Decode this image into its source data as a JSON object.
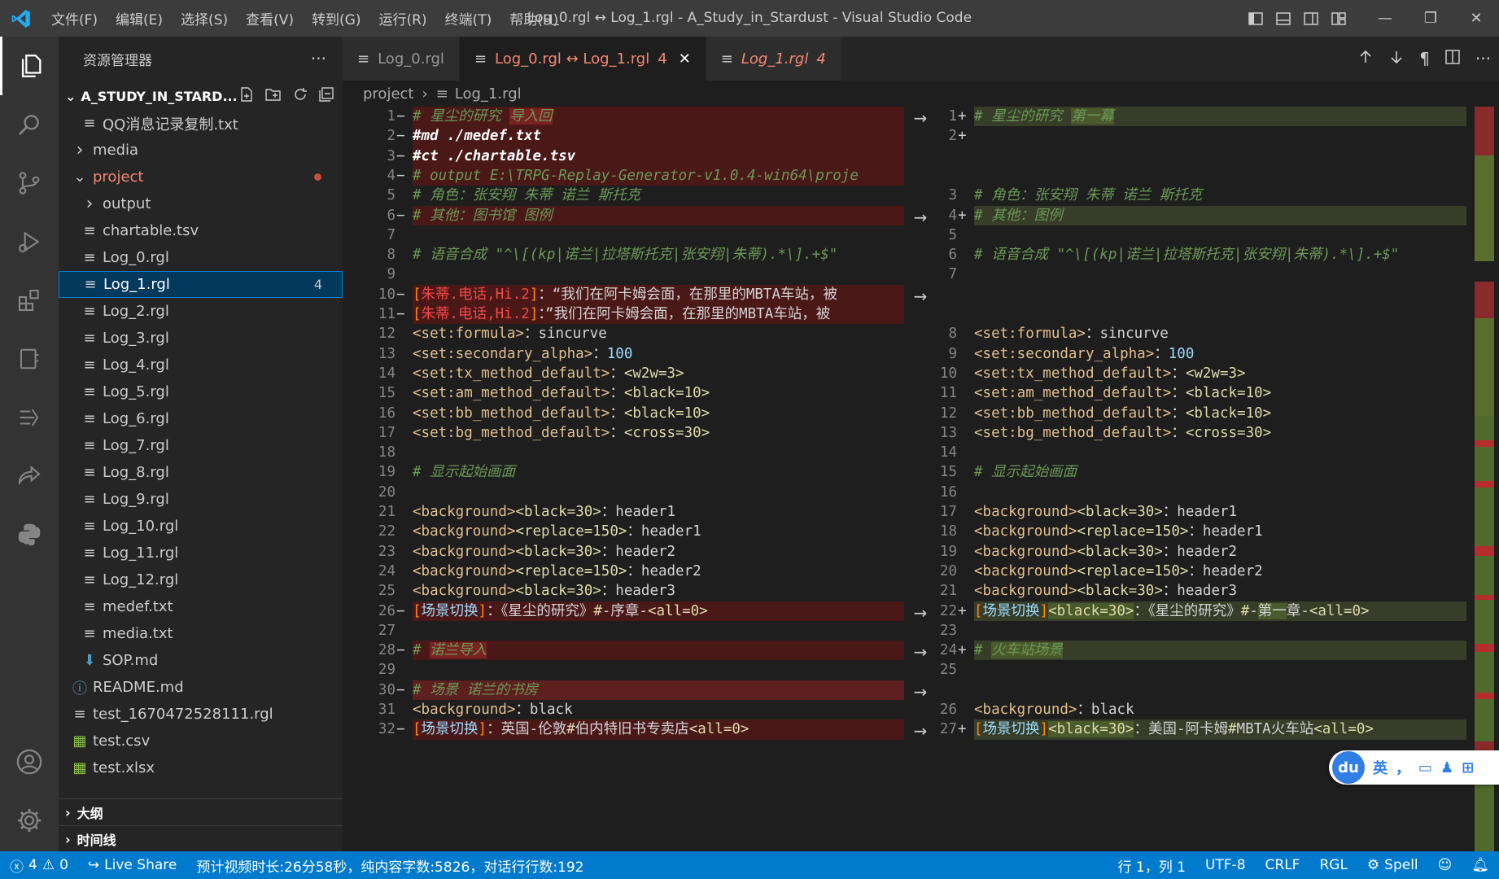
{
  "window": {
    "title": "Log_0.rgl ↔ Log_1.rgl - A_Study_in_Stardust - Visual Studio Code",
    "menu": [
      "文件(F)",
      "编辑(E)",
      "选择(S)",
      "查看(V)",
      "转到(G)",
      "运行(R)",
      "终端(T)",
      "帮助(H)"
    ]
  },
  "sidebar": {
    "title": "资源管理器",
    "folder": "A_STUDY_IN_STARD...",
    "items": [
      {
        "label": "QQ消息记录复制.txt",
        "indent": 2,
        "kind": "file"
      },
      {
        "label": "media",
        "indent": 1,
        "kind": "folder-closed"
      },
      {
        "label": "project",
        "indent": 1,
        "kind": "folder-open"
      },
      {
        "label": "output",
        "indent": 2,
        "kind": "folder-closed"
      },
      {
        "label": "chartable.tsv",
        "indent": 2,
        "kind": "file"
      },
      {
        "label": "Log_0.rgl",
        "indent": 2,
        "kind": "file"
      },
      {
        "label": "Log_1.rgl",
        "indent": 2,
        "kind": "file",
        "badge": "4"
      },
      {
        "label": "Log_2.rgl",
        "indent": 2,
        "kind": "file"
      },
      {
        "label": "Log_3.rgl",
        "indent": 2,
        "kind": "file"
      },
      {
        "label": "Log_4.rgl",
        "indent": 2,
        "kind": "file"
      },
      {
        "label": "Log_5.rgl",
        "indent": 2,
        "kind": "file"
      },
      {
        "label": "Log_6.rgl",
        "indent": 2,
        "kind": "file"
      },
      {
        "label": "Log_7.rgl",
        "indent": 2,
        "kind": "file"
      },
      {
        "label": "Log_8.rgl",
        "indent": 2,
        "kind": "file"
      },
      {
        "label": "Log_9.rgl",
        "indent": 2,
        "kind": "file"
      },
      {
        "label": "Log_10.rgl",
        "indent": 2,
        "kind": "file"
      },
      {
        "label": "Log_11.rgl",
        "indent": 2,
        "kind": "file"
      },
      {
        "label": "Log_12.rgl",
        "indent": 2,
        "kind": "file"
      },
      {
        "label": "medef.txt",
        "indent": 2,
        "kind": "file"
      },
      {
        "label": "media.txt",
        "indent": 2,
        "kind": "file"
      },
      {
        "label": "SOP.md",
        "indent": 2,
        "kind": "md"
      },
      {
        "label": "README.md",
        "indent": 1,
        "kind": "info"
      },
      {
        "label": "test_1670472528111.rgl",
        "indent": 1,
        "kind": "file"
      },
      {
        "label": "test.csv",
        "indent": 1,
        "kind": "csv"
      },
      {
        "label": "test.xlsx",
        "indent": 1,
        "kind": "xlsx"
      }
    ],
    "outline": "大纲",
    "timeline": "时间线"
  },
  "tabs": [
    {
      "label": "Log_0.rgl",
      "active": false,
      "modified": false
    },
    {
      "label": "Log_0.rgl ↔ Log_1.rgl",
      "badge": "4",
      "active": true,
      "close": "✕"
    },
    {
      "label": "Log_1.rgl",
      "badge": "4",
      "active": false,
      "italic": true
    }
  ],
  "breadcrumb": {
    "folder": "project",
    "file": "Log_1.rgl"
  },
  "left_lines": [
    {
      "n": "1",
      "m": "−",
      "t": "del",
      "parts": [
        [
          "c-com",
          "# 星尘的研究 "
        ],
        [
          "c-com hl-del",
          "导入回"
        ]
      ]
    },
    {
      "n": "2",
      "m": "−",
      "t": "del",
      "parts": [
        [
          "c-dir",
          "#md ./medef.txt"
        ]
      ]
    },
    {
      "n": "3",
      "m": "−",
      "t": "del",
      "parts": [
        [
          "c-dir",
          "#ct ./chartable.tsv"
        ]
      ]
    },
    {
      "n": "4",
      "m": "−",
      "t": "del",
      "parts": [
        [
          "c-com",
          "# output E:\\TRPG-Replay-Generator-v1.0.4-win64\\proje"
        ]
      ]
    },
    {
      "n": "5",
      "m": "",
      "t": "",
      "parts": [
        [
          "c-com",
          "# 角色：张安翔 朱蒂 诺兰 斯托克"
        ]
      ]
    },
    {
      "n": "6",
      "m": "−",
      "t": "del",
      "parts": [
        [
          "c-com",
          "# 其他：图书馆 图例"
        ]
      ]
    },
    {
      "n": "7",
      "m": "",
      "t": "",
      "parts": []
    },
    {
      "n": "8",
      "m": "",
      "t": "",
      "parts": [
        [
          "c-com",
          "# 语音合成 \"^\\[(kp|诺兰|拉塔斯托克|张安翔|朱蒂).*\\].+$\""
        ]
      ]
    },
    {
      "n": "9",
      "m": "",
      "t": "",
      "parts": []
    },
    {
      "n": "10",
      "m": "−",
      "t": "del",
      "parts": [
        [
          "c-org",
          "["
        ],
        [
          "c-red",
          "朱蒂.电话,Hi.2"
        ],
        [
          "c-org",
          "]"
        ],
        [
          "",
          "：“我们在阿卡姆会面，在那里的MBTA车站，被"
        ]
      ]
    },
    {
      "n": "11",
      "m": "−",
      "t": "del",
      "parts": [
        [
          "c-org",
          "["
        ],
        [
          "c-red",
          "朱蒂.电话,Hi.2"
        ],
        [
          "c-org",
          "]"
        ],
        [
          "",
          "：”我们在阿卡姆会面，在那里的MBTA车站，被"
        ]
      ]
    },
    {
      "n": "12",
      "m": "",
      "t": "",
      "parts": [
        [
          "c-yel",
          "<set:formula>"
        ],
        [
          "",
          "：sincurve"
        ]
      ]
    },
    {
      "n": "13",
      "m": "",
      "t": "",
      "parts": [
        [
          "c-yel",
          "<set:secondary_alpha>"
        ],
        [
          "",
          "："
        ],
        [
          "c-blue",
          "100"
        ]
      ]
    },
    {
      "n": "14",
      "m": "",
      "t": "",
      "parts": [
        [
          "c-yel",
          "<set:tx_method_default>"
        ],
        [
          "",
          "："
        ],
        [
          "c-tag2",
          "<w2w=3>"
        ]
      ]
    },
    {
      "n": "15",
      "m": "",
      "t": "",
      "parts": [
        [
          "c-yel",
          "<set:am_method_default>"
        ],
        [
          "",
          "："
        ],
        [
          "c-tag2",
          "<black=10>"
        ]
      ]
    },
    {
      "n": "16",
      "m": "",
      "t": "",
      "parts": [
        [
          "c-yel",
          "<set:bb_method_default>"
        ],
        [
          "",
          "："
        ],
        [
          "c-tag2",
          "<black=10>"
        ]
      ]
    },
    {
      "n": "17",
      "m": "",
      "t": "",
      "parts": [
        [
          "c-yel",
          "<set:bg_method_default>"
        ],
        [
          "",
          "："
        ],
        [
          "c-tag2",
          "<cross=30>"
        ]
      ]
    },
    {
      "n": "18",
      "m": "",
      "t": "",
      "parts": []
    },
    {
      "n": "19",
      "m": "",
      "t": "",
      "parts": [
        [
          "c-com",
          "# 显示起始画面"
        ]
      ]
    },
    {
      "n": "20",
      "m": "",
      "t": "",
      "parts": []
    },
    {
      "n": "21",
      "m": "",
      "t": "",
      "parts": [
        [
          "c-yel",
          "<background>"
        ],
        [
          "c-tag2",
          "<black=30>"
        ],
        [
          "",
          "：header1"
        ]
      ]
    },
    {
      "n": "22",
      "m": "",
      "t": "",
      "parts": [
        [
          "c-yel",
          "<background>"
        ],
        [
          "c-tag2",
          "<replace=150>"
        ],
        [
          "",
          "：header1"
        ]
      ]
    },
    {
      "n": "23",
      "m": "",
      "t": "",
      "parts": [
        [
          "c-yel",
          "<background>"
        ],
        [
          "c-tag2",
          "<black=30>"
        ],
        [
          "",
          "：header2"
        ]
      ]
    },
    {
      "n": "24",
      "m": "",
      "t": "",
      "parts": [
        [
          "c-yel",
          "<background>"
        ],
        [
          "c-tag2",
          "<replace=150>"
        ],
        [
          "",
          "：header2"
        ]
      ]
    },
    {
      "n": "25",
      "m": "",
      "t": "",
      "parts": [
        [
          "c-yel",
          "<background>"
        ],
        [
          "c-tag2",
          "<black=30>"
        ],
        [
          "",
          "：header3"
        ]
      ]
    },
    {
      "n": "26",
      "m": "−",
      "t": "del",
      "parts": [
        [
          "c-org",
          "["
        ],
        [
          "c-blue",
          "场景切换"
        ],
        [
          "c-org",
          "]"
        ],
        [
          "",
          "：《星尘的研究》"
        ],
        [
          "c-tag2",
          "#"
        ],
        [
          "",
          "-序章-"
        ],
        [
          "c-tag2",
          "<all=0>"
        ]
      ]
    },
    {
      "n": "27",
      "m": "",
      "t": "",
      "parts": []
    },
    {
      "n": "28",
      "m": "−",
      "t": "del",
      "parts": [
        [
          "c-com",
          "# "
        ],
        [
          "c-com hl-del",
          "诺兰导入"
        ]
      ]
    },
    {
      "n": "29",
      "m": "",
      "t": "",
      "parts": []
    },
    {
      "n": "30",
      "m": "−",
      "t": "del strong",
      "parts": [
        [
          "c-com",
          "# 场景 诺兰的书房"
        ]
      ]
    },
    {
      "n": "31",
      "m": "",
      "t": "",
      "parts": [
        [
          "c-yel",
          "<background>"
        ],
        [
          "",
          "：black"
        ]
      ]
    },
    {
      "n": "32",
      "m": "−",
      "t": "del",
      "parts": [
        [
          "c-org",
          "["
        ],
        [
          "c-blue",
          "场景切换"
        ],
        [
          "c-org",
          "]"
        ],
        [
          "",
          "：英国-伦敦"
        ],
        [
          "c-tag2",
          "#"
        ],
        [
          "",
          "伯内特旧书专卖店"
        ],
        [
          "c-tag2",
          "<all=0>"
        ]
      ]
    }
  ],
  "right_lines": [
    {
      "n": "1",
      "m": "+",
      "t": "ins",
      "parts": [
        [
          "c-com",
          "# 星尘的研究 "
        ],
        [
          "c-com hl-ins",
          "第一幕"
        ]
      ]
    },
    {
      "n": "2",
      "m": "+",
      "t": "ins",
      "parts": []
    },
    {
      "n": "",
      "m": "",
      "t": "hatch",
      "parts": []
    },
    {
      "n": "",
      "m": "",
      "t": "hatch",
      "parts": []
    },
    {
      "n": "3",
      "m": "",
      "t": "",
      "parts": [
        [
          "c-com",
          "# 角色：张安翔 朱蒂 诺兰 斯托克"
        ]
      ]
    },
    {
      "n": "4",
      "m": "+",
      "t": "ins",
      "parts": [
        [
          "c-com",
          "# 其他：图例"
        ]
      ]
    },
    {
      "n": "5",
      "m": "",
      "t": "",
      "parts": []
    },
    {
      "n": "6",
      "m": "",
      "t": "",
      "parts": [
        [
          "c-com",
          "# 语音合成 \"^\\[(kp|诺兰|拉塔斯托克|张安翔|朱蒂).*\\].+$\""
        ]
      ]
    },
    {
      "n": "7",
      "m": "",
      "t": "",
      "parts": []
    },
    {
      "n": "",
      "m": "",
      "t": "hatch",
      "parts": []
    },
    {
      "n": "",
      "m": "",
      "t": "hatch",
      "parts": []
    },
    {
      "n": "8",
      "m": "",
      "t": "",
      "parts": [
        [
          "c-yel",
          "<set:formula>"
        ],
        [
          "",
          "：sincurve"
        ]
      ]
    },
    {
      "n": "9",
      "m": "",
      "t": "",
      "parts": [
        [
          "c-yel",
          "<set:secondary_alpha>"
        ],
        [
          "",
          "："
        ],
        [
          "c-blue",
          "100"
        ]
      ]
    },
    {
      "n": "10",
      "m": "",
      "t": "",
      "parts": [
        [
          "c-yel",
          "<set:tx_method_default>"
        ],
        [
          "",
          "："
        ],
        [
          "c-tag2",
          "<w2w=3>"
        ]
      ]
    },
    {
      "n": "11",
      "m": "",
      "t": "",
      "parts": [
        [
          "c-yel",
          "<set:am_method_default>"
        ],
        [
          "",
          "："
        ],
        [
          "c-tag2",
          "<black=10>"
        ]
      ]
    },
    {
      "n": "12",
      "m": "",
      "t": "",
      "parts": [
        [
          "c-yel",
          "<set:bb_method_default>"
        ],
        [
          "",
          "："
        ],
        [
          "c-tag2",
          "<black=10>"
        ]
      ]
    },
    {
      "n": "13",
      "m": "",
      "t": "",
      "parts": [
        [
          "c-yel",
          "<set:bg_method_default>"
        ],
        [
          "",
          "："
        ],
        [
          "c-tag2",
          "<cross=30>"
        ]
      ]
    },
    {
      "n": "14",
      "m": "",
      "t": "",
      "parts": []
    },
    {
      "n": "15",
      "m": "",
      "t": "",
      "parts": [
        [
          "c-com",
          "# 显示起始画面"
        ]
      ]
    },
    {
      "n": "16",
      "m": "",
      "t": "",
      "parts": []
    },
    {
      "n": "17",
      "m": "",
      "t": "",
      "parts": [
        [
          "c-yel",
          "<background>"
        ],
        [
          "c-tag2",
          "<black=30>"
        ],
        [
          "",
          "：header1"
        ]
      ]
    },
    {
      "n": "18",
      "m": "",
      "t": "",
      "parts": [
        [
          "c-yel",
          "<background>"
        ],
        [
          "c-tag2",
          "<replace=150>"
        ],
        [
          "",
          "：header1"
        ]
      ]
    },
    {
      "n": "19",
      "m": "",
      "t": "",
      "parts": [
        [
          "c-yel",
          "<background>"
        ],
        [
          "c-tag2",
          "<black=30>"
        ],
        [
          "",
          "：header2"
        ]
      ]
    },
    {
      "n": "20",
      "m": "",
      "t": "",
      "parts": [
        [
          "c-yel",
          "<background>"
        ],
        [
          "c-tag2",
          "<replace=150>"
        ],
        [
          "",
          "：header2"
        ]
      ]
    },
    {
      "n": "21",
      "m": "",
      "t": "",
      "parts": [
        [
          "c-yel",
          "<background>"
        ],
        [
          "c-tag2",
          "<black=30>"
        ],
        [
          "",
          "：header3"
        ]
      ]
    },
    {
      "n": "22",
      "m": "+",
      "t": "ins",
      "parts": [
        [
          "c-org",
          "["
        ],
        [
          "c-blue",
          "场景切换"
        ],
        [
          "c-org",
          "]"
        ],
        [
          "c-tag2 hl-ins",
          "<black=30>"
        ],
        [
          "",
          "：《星尘的研究》"
        ],
        [
          "c-tag2",
          "#"
        ],
        [
          "",
          "-"
        ],
        [
          "hl-ins",
          "第一"
        ],
        [
          "",
          "章-"
        ],
        [
          "c-tag2",
          "<all=0>"
        ]
      ]
    },
    {
      "n": "23",
      "m": "",
      "t": "",
      "parts": []
    },
    {
      "n": "24",
      "m": "+",
      "t": "ins",
      "parts": [
        [
          "c-com",
          "# "
        ],
        [
          "c-com hl-ins",
          "火车站场景"
        ]
      ]
    },
    {
      "n": "25",
      "m": "",
      "t": "",
      "parts": []
    },
    {
      "n": "",
      "m": "",
      "t": "hatch",
      "parts": []
    },
    {
      "n": "26",
      "m": "",
      "t": "",
      "parts": [
        [
          "c-yel",
          "<background>"
        ],
        [
          "",
          "：black"
        ]
      ]
    },
    {
      "n": "27",
      "m": "+",
      "t": "ins",
      "parts": [
        [
          "c-org",
          "["
        ],
        [
          "c-blue",
          "场景切换"
        ],
        [
          "c-org",
          "]"
        ],
        [
          "c-tag2 hl-ins",
          "<black=30>"
        ],
        [
          "",
          "：美国-阿卡姆"
        ],
        [
          "c-tag2",
          "#"
        ],
        [
          "",
          "MBTA火车站"
        ],
        [
          "c-tag2",
          "<all=0>"
        ]
      ]
    }
  ],
  "arrow_rows": [
    0,
    5,
    9,
    25,
    27,
    29,
    31
  ],
  "status": {
    "errors": "4",
    "warnings": "0",
    "live_share": "Live Share",
    "info": "预计视频时长:26分58秒，纯内容字数:5826，对话行行数:192",
    "position": "行 1，列 1",
    "encoding": "UTF-8",
    "eol": "CRLF",
    "language": "RGL",
    "spell": "Spell"
  },
  "ime": {
    "logo": "du",
    "lang": "英",
    "punct": "，"
  },
  "colors": {
    "accent": "#007acc",
    "deleted": "#4b1818",
    "inserted": "#373d29"
  }
}
